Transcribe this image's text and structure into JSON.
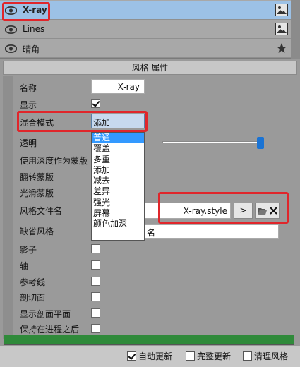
{
  "style_list": {
    "items": [
      {
        "name": "X-ray",
        "icon": "image-thumbnail-icon",
        "selected": true
      },
      {
        "name": "Lines",
        "icon": "image-thumbnail-icon",
        "selected": false
      },
      {
        "name": "晴角",
        "icon": "star-icon",
        "selected": false
      }
    ]
  },
  "properties": {
    "title": "风格 属性",
    "labels": {
      "name": "名称",
      "display": "显示",
      "blend_mode": "混合模式",
      "transparency": "透明",
      "use_depth_mask": "使用深度作为蒙版",
      "flip_mask": "翻转蒙版",
      "smooth_mask": "光滑蒙版",
      "style_file": "风格文件名",
      "default_style": "缺省风格",
      "shadow": "影子",
      "axis": "轴",
      "reference_line": "参考线",
      "section_plane": "剖切面",
      "show_section_plane": "显示剖面平面",
      "keep_after_process": "保持在进程之后"
    },
    "name_value": "X-ray",
    "display_checked": true,
    "blend_mode_value": "添加",
    "blend_options": [
      "普通",
      "覆盖",
      "多重",
      "添加",
      "减去",
      "差异",
      "强光",
      "屏幕",
      "颜色加深"
    ],
    "blend_selected_index": 0,
    "transparency_level": 0.98,
    "style_file_value": "X-ray.style",
    "browse_label": ">",
    "default_style_value": "名"
  },
  "footer": {
    "auto_update": "自动更新",
    "auto_update_checked": true,
    "full_update": "完整更新",
    "clear_style": "清理风格"
  },
  "colors": {
    "selection": "#9cc1e6",
    "highlight": "#e0262b",
    "progress": "#2f8a3a"
  }
}
